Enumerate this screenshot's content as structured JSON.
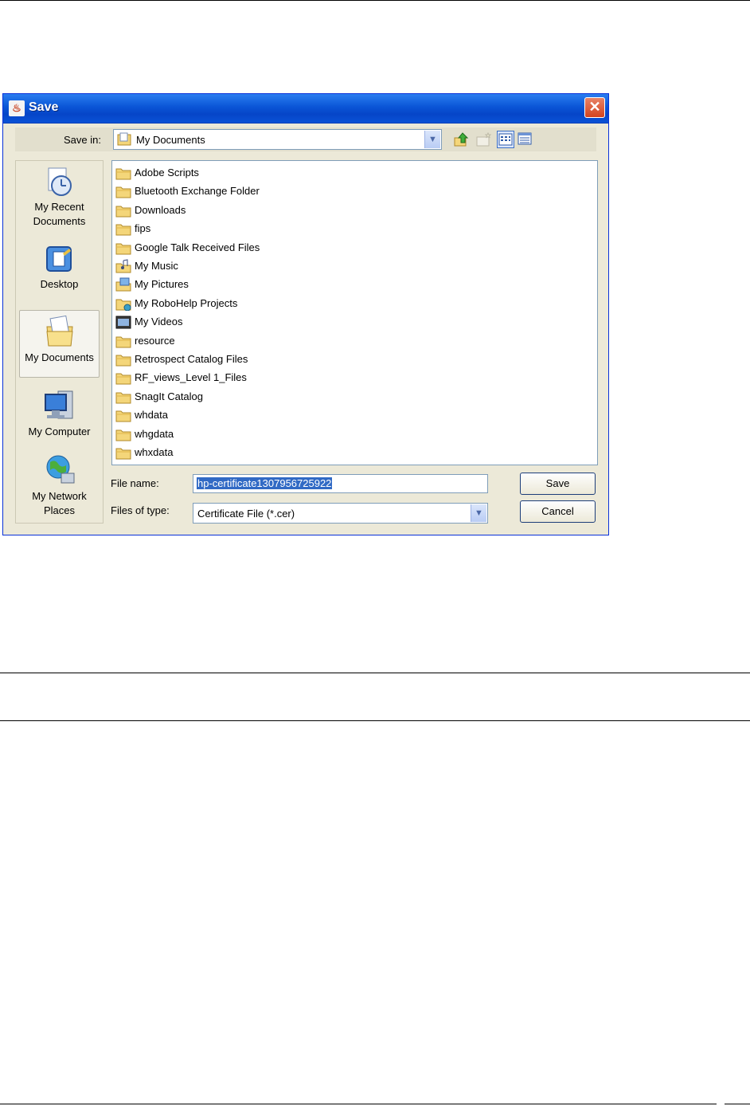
{
  "dialog": {
    "title": "Save",
    "save_in_label": "Save in:",
    "save_in_value": "My Documents",
    "file_name_label": "File name:",
    "file_name_value": "hp-certificate1307956725922",
    "files_of_type_label": "Files of type:",
    "files_of_type_value": "Certificate File (*.cer)",
    "save_button": "Save",
    "cancel_button": "Cancel"
  },
  "places": [
    {
      "line1": "My Recent",
      "line2": "Documents",
      "icon": "recent-documents-icon"
    },
    {
      "line1": "Desktop",
      "line2": "",
      "icon": "desktop-icon"
    },
    {
      "line1": "My Documents",
      "line2": "",
      "icon": "my-documents-icon"
    },
    {
      "line1": "My Computer",
      "line2": "",
      "icon": "my-computer-icon"
    },
    {
      "line1": "My Network",
      "line2": "Places",
      "icon": "network-places-icon"
    }
  ],
  "files": [
    {
      "name": "Adobe Scripts",
      "icon": "folder-icon"
    },
    {
      "name": "Bluetooth Exchange Folder",
      "icon": "folder-icon"
    },
    {
      "name": "Downloads",
      "icon": "folder-icon"
    },
    {
      "name": "fips",
      "icon": "folder-icon"
    },
    {
      "name": "Google Talk Received Files",
      "icon": "folder-icon"
    },
    {
      "name": "My Music",
      "icon": "music-folder-icon"
    },
    {
      "name": "My Pictures",
      "icon": "pictures-folder-icon"
    },
    {
      "name": "My RoboHelp Projects",
      "icon": "robohelp-folder-icon"
    },
    {
      "name": "My Videos",
      "icon": "videos-folder-icon"
    },
    {
      "name": "resource",
      "icon": "folder-icon"
    },
    {
      "name": "Retrospect Catalog Files",
      "icon": "folder-icon"
    },
    {
      "name": "RF_views_Level 1_Files",
      "icon": "folder-icon"
    },
    {
      "name": "SnagIt Catalog",
      "icon": "folder-icon"
    },
    {
      "name": "whdata",
      "icon": "folder-icon"
    },
    {
      "name": "whgdata",
      "icon": "folder-icon"
    },
    {
      "name": "whxdata",
      "icon": "folder-icon"
    }
  ],
  "colors": {
    "titlebar": "#0a55d6",
    "dialog_bg": "#ece9d8",
    "selection": "#316ac5",
    "folder": "#f4d67a"
  }
}
